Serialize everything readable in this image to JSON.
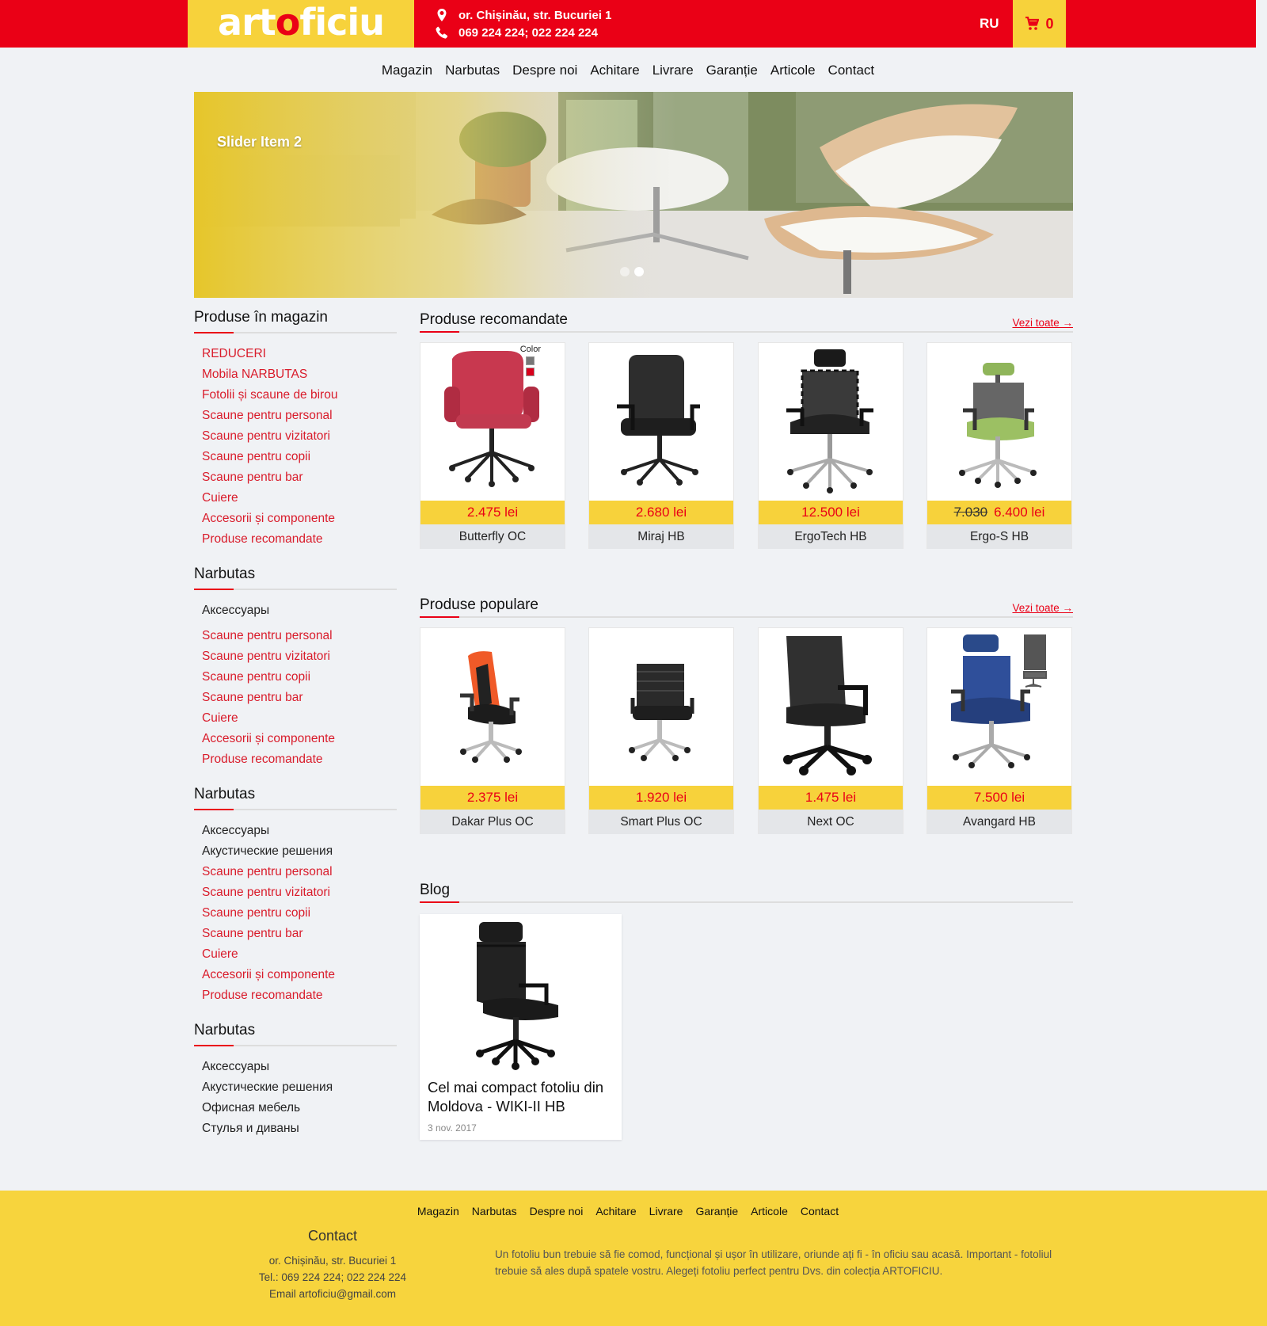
{
  "header": {
    "logo_art": "art",
    "logo_o": "o",
    "logo_ficiu": "ficiu",
    "address": "or. Chișinău, str. Bucuriei 1",
    "phones": "069 224 224; 022 224 224",
    "lang": "RU",
    "cart_count": "0",
    "colors": {
      "red": "#ea0016",
      "yellow": "#f7d23b"
    }
  },
  "nav": [
    "Magazin",
    "Narbutas",
    "Despre noi",
    "Achitare",
    "Livrare",
    "Garanție",
    "Articole",
    "Contact"
  ],
  "slider": {
    "caption": "Slider Item 2",
    "slides": 2,
    "active": 2
  },
  "sidebar": {
    "block1": {
      "title": "Produse în magazin",
      "items": [
        "REDUCERI",
        "Mobila NARBUTAS",
        "Fotolii și scaune de birou",
        "Scaune pentru personal",
        "Scaune pentru vizitatori",
        "Scaune pentru copii",
        "Scaune pentru bar",
        "Cuiere",
        "Accesorii și componente",
        "Produse recomandate"
      ]
    },
    "block2": {
      "title": "Narbutas",
      "items": [
        "Аксессуары",
        "Scaune pentru personal",
        "Scaune pentru vizitatori",
        "Scaune pentru copii",
        "Scaune pentru bar",
        "Cuiere",
        "Accesorii și componente",
        "Produse recomandate"
      ]
    },
    "block3": {
      "title": "Narbutas",
      "items": [
        "Аксессуары",
        "Акустические решения",
        "Scaune pentru personal",
        "Scaune pentru vizitatori",
        "Scaune pentru copii",
        "Scaune pentru bar",
        "Cuiere",
        "Accesorii și componente",
        "Produse recomandate"
      ]
    },
    "block4": {
      "title": "Narbutas",
      "items": [
        "Аксессуары",
        "Акустические решения",
        "Офисная мебель",
        "Стулья и диваны"
      ]
    }
  },
  "recommended": {
    "title": "Produse recomandate",
    "link": "Vezi toate →",
    "color_label": "Color",
    "products": [
      {
        "name": "Butterfly OC",
        "price": "2.475 lei",
        "old_price": ""
      },
      {
        "name": "Miraj HB",
        "price": "2.680 lei",
        "old_price": ""
      },
      {
        "name": "ErgoTech HB",
        "price": "12.500 lei",
        "old_price": ""
      },
      {
        "name": "Ergo-S HB",
        "price": "6.400 lei",
        "old_price": "7.030"
      }
    ]
  },
  "popular": {
    "title": "Produse populare",
    "link": "Vezi toate →",
    "products": [
      {
        "name": "Dakar Plus OC",
        "price": "2.375 lei"
      },
      {
        "name": "Smart Plus OC",
        "price": "1.920 lei"
      },
      {
        "name": "Next OC",
        "price": "1.475 lei"
      },
      {
        "name": "Avangard HB",
        "price": "7.500 lei"
      }
    ]
  },
  "blog": {
    "title": "Blog",
    "post": {
      "title": "Cel mai compact fotoliu din Moldova - WIKI-II HB",
      "date": "3 nov. 2017"
    }
  },
  "footer": {
    "nav": [
      "Magazin",
      "Narbutas",
      "Despre noi",
      "Achitare",
      "Livrare",
      "Garanție",
      "Articole",
      "Contact"
    ],
    "contact_title": "Contact",
    "address": "or. Chișinău, str. Bucuriei 1",
    "tel": "Tel.: 069 224 224; 022 224 224",
    "email": "Email artoficiu@gmail.com",
    "text": "Un fotoliu bun trebuie să fie comod, funcțional și ușor în utilizare, oriunde ați fi - în oficiu sau acasă. Important - fotoliul trebuie să ales după spatele vostru. Alegeți fotoliu perfect pentru Dvs. din colecția ARTOFICIU."
  }
}
